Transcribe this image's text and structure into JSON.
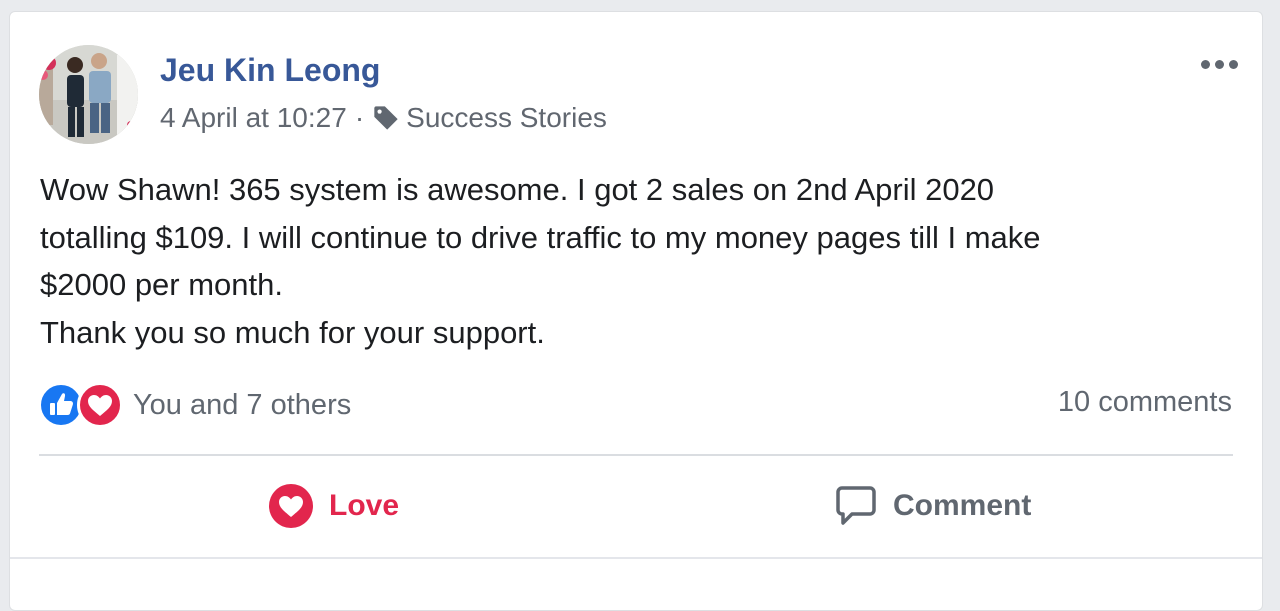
{
  "post": {
    "author": "Jeu Kin Leong",
    "timestamp": "4 April at 10:27",
    "separator": "·",
    "topic": "Success Stories",
    "body_lines": [
      "Wow Shawn! 365 system is awesome. I got 2 sales on 2nd April 2020",
      "totalling $109. I will continue to drive traffic to my money pages till I make",
      "$2000 per month.",
      "Thank you so much for your support."
    ],
    "reactions_text": "You and 7 others",
    "comments_text": "10 comments"
  },
  "actions": {
    "love_label": "Love",
    "comment_label": "Comment"
  },
  "icons": {
    "more": "more-options-icon",
    "tag": "tag-icon",
    "like": "like-reaction-icon",
    "love": "love-reaction-icon",
    "comment": "comment-icon"
  },
  "colors": {
    "author": "#385898",
    "love": "#e2264d",
    "like": "#1877f2",
    "muted": "#606770"
  }
}
